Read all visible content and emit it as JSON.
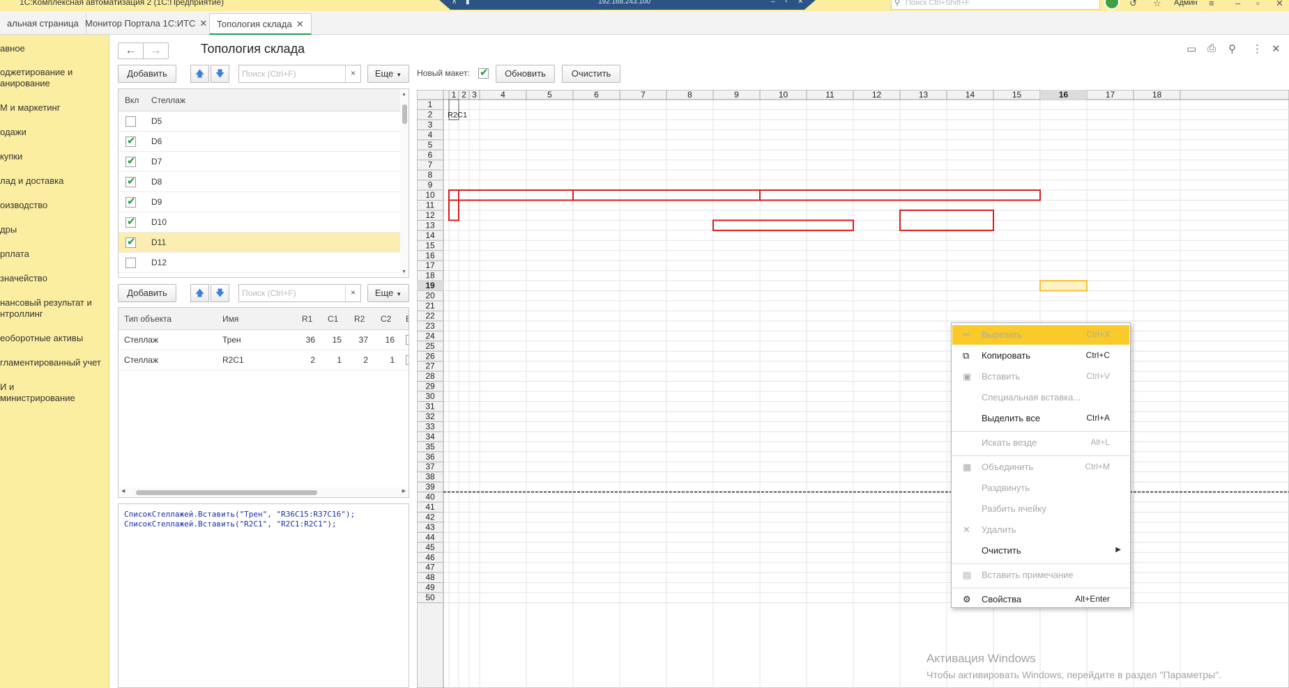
{
  "titlebar": {
    "app_title": "1С:Комплексная автоматизация 2  (1С:Предприятие)",
    "remote_ip": "192.168.243.100",
    "search_placeholder": "Поиск Ctrl+Shift+F",
    "user": "Админ"
  },
  "tabs": [
    {
      "label": "альная страница",
      "active": false
    },
    {
      "label": "Монитор Портала 1С:ИТС",
      "active": false
    },
    {
      "label": "Топология склада",
      "active": true
    }
  ],
  "sidebar": {
    "items": [
      "авное",
      "оджетирование и\nанирование",
      "М и маркетинг",
      "одажи",
      "купки",
      "лад и доставка",
      "оизводство",
      "дры",
      "рплата",
      "значейство",
      "нансовый результат и\nнтроллинг",
      "еоборотные активы",
      "гламентированный учет",
      "И и\nминистрирование"
    ]
  },
  "form": {
    "title": "Топология склада",
    "add_label": "Добавить",
    "search_placeholder": "Поиск (Ctrl+F)",
    "more_label": "Еще",
    "new_layout_label": "Новый макет:",
    "new_layout_checked": true,
    "refresh_label": "Обновить",
    "clear_label": "Очистить"
  },
  "racks": {
    "col_enabled": "Вкл",
    "col_rack": "Стеллаж",
    "rows": [
      {
        "name": "D5",
        "checked": false
      },
      {
        "name": "D6",
        "checked": true
      },
      {
        "name": "D7",
        "checked": true
      },
      {
        "name": "D8",
        "checked": true
      },
      {
        "name": "D9",
        "checked": true
      },
      {
        "name": "D10",
        "checked": true
      },
      {
        "name": "D11",
        "checked": true,
        "selected": true
      },
      {
        "name": "D12",
        "checked": false
      }
    ]
  },
  "objects": {
    "headers": [
      "Тип объекта",
      "Имя",
      "R1",
      "C1",
      "R2",
      "C2",
      "В"
    ],
    "rows": [
      {
        "type": "Стеллаж",
        "name": "Трен",
        "r1": "36",
        "c1": "15",
        "r2": "37",
        "c2": "16"
      },
      {
        "type": "Стеллаж",
        "name": "R2C1",
        "r1": "2",
        "c1": "1",
        "r2": "2",
        "c2": "1"
      }
    ]
  },
  "code": {
    "text": "СписокСтеллажей.Вставить(\"Трен\", \"R36C15:R37C16\");\nСписокСтеллажей.Вставить(\"R2C1\", \"R2C1:R2C1\");"
  },
  "sheet": {
    "col_labels": [
      "1",
      "2",
      "3",
      "4",
      "5",
      "6",
      "7",
      "8",
      "9",
      "10",
      "11",
      "12",
      "13",
      "14",
      "15",
      "16",
      "17",
      "18"
    ],
    "row_count": 50,
    "active_col": 16,
    "active_row": 19,
    "cell_text": "R2C1",
    "border_color": "#d81b1b"
  },
  "context_menu": {
    "items": [
      {
        "label": "Вырезать",
        "shortcut": "Ctrl+X",
        "icon": "✂",
        "enabled": false,
        "highlight": true
      },
      {
        "label": "Копировать",
        "shortcut": "Ctrl+C",
        "icon": "⧉",
        "enabled": true
      },
      {
        "label": "Вставить",
        "shortcut": "Ctrl+V",
        "icon": "▣",
        "enabled": false
      },
      {
        "label": "Специальная вставка...",
        "shortcut": "",
        "icon": "",
        "enabled": false
      },
      {
        "label": "Выделить все",
        "shortcut": "Ctrl+A",
        "icon": "",
        "enabled": true
      },
      {
        "label": "Искать везде",
        "shortcut": "Alt+L",
        "icon": "",
        "enabled": false
      },
      {
        "label": "Объединить",
        "shortcut": "Ctrl+M",
        "icon": "▦",
        "enabled": false
      },
      {
        "label": "Раздвинуть",
        "shortcut": "",
        "icon": "",
        "enabled": false
      },
      {
        "label": "Разбить ячейку",
        "shortcut": "",
        "icon": "",
        "enabled": false
      },
      {
        "label": "Удалить",
        "shortcut": "",
        "icon": "✕",
        "enabled": false
      },
      {
        "label": "Очистить",
        "shortcut": "",
        "icon": "",
        "enabled": true,
        "submenu": true
      },
      {
        "label": "Вставить примечание",
        "shortcut": "",
        "icon": "▤",
        "enabled": false
      },
      {
        "label": "Свойства",
        "shortcut": "Alt+Enter",
        "icon": "⚙",
        "enabled": true
      }
    ]
  },
  "watermark": {
    "title": "Активация Windows",
    "text": "Чтобы активировать Windows, перейдите в раздел \"Параметры\"."
  }
}
